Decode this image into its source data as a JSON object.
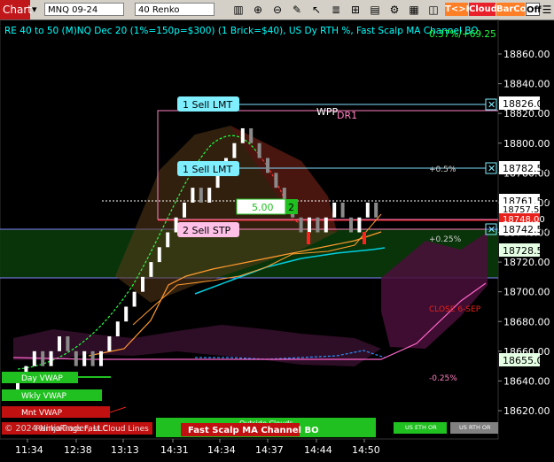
{
  "toolbar": {
    "chart_tab": "Chart",
    "instrument": "MNQ 09-24",
    "bar_type": "40 Renko",
    "tk_label": "T<>K",
    "cloud_label": "Cloud",
    "barcol_label": "BarCol",
    "off_label": "Off",
    "colors": {
      "tk": "#ff7f27",
      "cloud": "#e8212a",
      "barcol": "#ff7f27"
    },
    "icons": [
      "bar-chart-icon",
      "zoom-icon",
      "zoom-out-icon",
      "draw-icon",
      "cursor-icon",
      "properties-icon",
      "chart-trader-icon",
      "indicators-icon",
      "strategy-icon",
      "grid-icon",
      "order-icon",
      "menu-icon"
    ]
  },
  "chart_header": {
    "title": "RE 40 to 50 (M)NQ Dec 20 (1%=150p=$300) (1 Brick=$40), US Dy RTH %, Fast Scalp MA Channel BO",
    "pct_label": "0.37%/+69.25"
  },
  "orders": [
    {
      "label": "1 Sell LMT",
      "price": "18826.00"
    },
    {
      "label": "1 Sell LMT",
      "price": "18782.50"
    },
    {
      "label": "2 Sell STP",
      "price": "18742.50"
    }
  ],
  "price_box": {
    "value": "5.00",
    "qty": "2"
  },
  "annotations": {
    "wpp": "WPP",
    "dr1": "DR1",
    "plus05": "+0.5%",
    "plus025": "+0.25%",
    "minus025": "-0.25%",
    "close_sep": "CLOSE 6-SEP"
  },
  "right_labels": [
    {
      "price": "18826.00",
      "bg": "#ffffff"
    },
    {
      "price": "18782.50",
      "bg": "#ffffff"
    },
    {
      "price": "18761.50",
      "bg": "#ffffff"
    },
    {
      "price": "18757.50",
      "bg": "#ffffff"
    },
    {
      "price": "18748.00",
      "bg": "#e8211c"
    },
    {
      "price": "18742.50",
      "bg": "#ffffff"
    },
    {
      "price": "18728.56",
      "bg": "#e4ffe4"
    },
    {
      "price": "18655.07",
      "bg": "#e4ffe4"
    }
  ],
  "price_axis": [
    "18860.00",
    "18840.00",
    "18820.00",
    "18800.00",
    "18780.00",
    "18760.00",
    "18740.00",
    "18720.00",
    "18700.00",
    "18680.00",
    "18660.00",
    "18640.00",
    "18620.00"
  ],
  "time_axis": [
    "11:34",
    "12:38",
    "13:13",
    "14:31",
    "14:34",
    "14:37",
    "14:44",
    "14:50"
  ],
  "bottom": {
    "day_vwap": "Day VWAP",
    "wkly_vwap": "Wkly VWAP",
    "mnt_vwap": "Mnt VWAP",
    "copyright": "© 2024 NinjaTrader, LLC",
    "renko_kings": "RenkoKings Fast Cloud Lines",
    "outside_clouds": "Outside Clouds",
    "fast_scalp": "Fast Scalp MA Channel BO",
    "us_eth": "US ETH OR",
    "us_rth": "US RTH OR"
  },
  "chart_data": {
    "type": "candlestick",
    "ylim": [
      18610,
      18870
    ],
    "bricks": [
      {
        "o": 18630,
        "c": 18640
      },
      {
        "o": 18640,
        "c": 18650
      },
      {
        "o": 18650,
        "c": 18660
      },
      {
        "o": 18660,
        "c": 18650
      },
      {
        "o": 18650,
        "c": 18660
      },
      {
        "o": 18660,
        "c": 18670
      },
      {
        "o": 18670,
        "c": 18660
      },
      {
        "o": 18660,
        "c": 18650
      },
      {
        "o": 18650,
        "c": 18660
      },
      {
        "o": 18660,
        "c": 18650
      },
      {
        "o": 18650,
        "c": 18660
      },
      {
        "o": 18660,
        "c": 18670
      },
      {
        "o": 18670,
        "c": 18680
      },
      {
        "o": 18680,
        "c": 18690
      },
      {
        "o": 18690,
        "c": 18700
      },
      {
        "o": 18700,
        "c": 18710
      },
      {
        "o": 18710,
        "c": 18720
      },
      {
        "o": 18720,
        "c": 18730
      },
      {
        "o": 18730,
        "c": 18740
      },
      {
        "o": 18740,
        "c": 18750
      },
      {
        "o": 18750,
        "c": 18760
      },
      {
        "o": 18760,
        "c": 18770
      },
      {
        "o": 18770,
        "c": 18760
      },
      {
        "o": 18760,
        "c": 18770
      },
      {
        "o": 18770,
        "c": 18780
      },
      {
        "o": 18780,
        "c": 18790
      },
      {
        "o": 18790,
        "c": 18800
      },
      {
        "o": 18800,
        "c": 18810
      },
      {
        "o": 18810,
        "c": 18800
      },
      {
        "o": 18800,
        "c": 18790
      },
      {
        "o": 18790,
        "c": 18780
      },
      {
        "o": 18780,
        "c": 18770
      },
      {
        "o": 18770,
        "c": 18760
      },
      {
        "o": 18760,
        "c": 18750
      },
      {
        "o": 18750,
        "c": 18740
      },
      {
        "o": 18740,
        "c": 18750
      },
      {
        "o": 18750,
        "c": 18740
      },
      {
        "o": 18740,
        "c": 18750
      },
      {
        "o": 18750,
        "c": 18760
      },
      {
        "o": 18760,
        "c": 18750
      },
      {
        "o": 18750,
        "c": 18740
      },
      {
        "o": 18740,
        "c": 18750
      },
      {
        "o": 18750,
        "c": 18760
      },
      {
        "o": 18760,
        "c": 18750
      }
    ]
  }
}
